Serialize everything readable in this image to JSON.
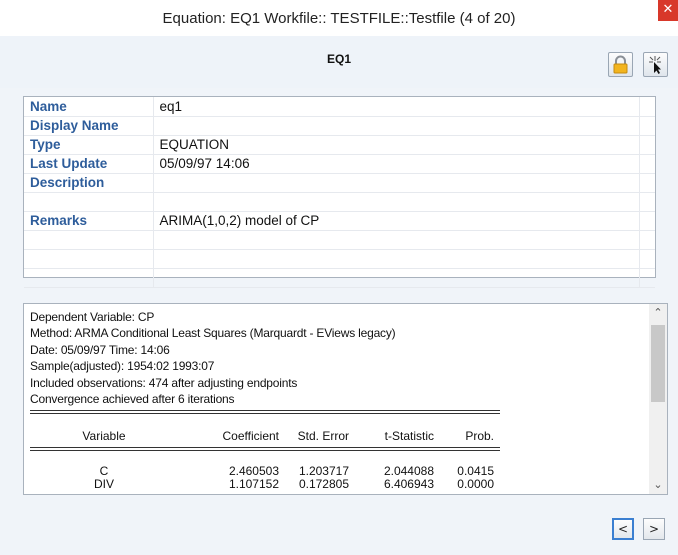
{
  "window": {
    "title": "Equation: EQ1 Workfile:: TESTFILE::Testfile (4 of 20)",
    "close_glyph": "✕"
  },
  "header": {
    "object_name": "EQ1",
    "lock_icon": "lock-icon",
    "pointer_icon": "pointer-icon"
  },
  "info": {
    "rows": [
      {
        "label": "Name",
        "value": "eq1"
      },
      {
        "label": "Display Name",
        "value": ""
      },
      {
        "label": "Type",
        "value": "EQUATION"
      },
      {
        "label": "Last Update",
        "value": "05/09/97  14:06"
      },
      {
        "label": "Description",
        "value": ""
      },
      {
        "label": "",
        "value": ""
      },
      {
        "label": "Remarks",
        "value": "ARIMA(1,0,2) model of CP"
      },
      {
        "label": "",
        "value": ""
      },
      {
        "label": "",
        "value": ""
      },
      {
        "label": "",
        "value": ""
      }
    ]
  },
  "output": {
    "lines": [
      "Dependent Variable: CP",
      "Method: ARMA Conditional Least Squares (Marquardt - EViews legacy)",
      "Date: 05/09/97   Time: 14:06",
      "Sample(adjusted): 1954:02 1993:07",
      "Included observations: 474 after adjusting endpoints",
      "Convergence achieved after 6 iterations"
    ],
    "columns": [
      "Variable",
      "Coefficient",
      "Std. Error",
      "t-Statistic",
      "Prob."
    ],
    "rows": [
      [
        "C",
        "2.460503",
        "1.203717",
        "2.044088",
        "0.0415"
      ],
      [
        "DIV",
        "1.107152",
        "0.172805",
        "6.406943",
        "0.0000"
      ]
    ]
  },
  "scroll": {
    "up_glyph": "⌃",
    "down_glyph": "⌄"
  },
  "nav": {
    "prev_label": "<",
    "next_label": ">"
  }
}
